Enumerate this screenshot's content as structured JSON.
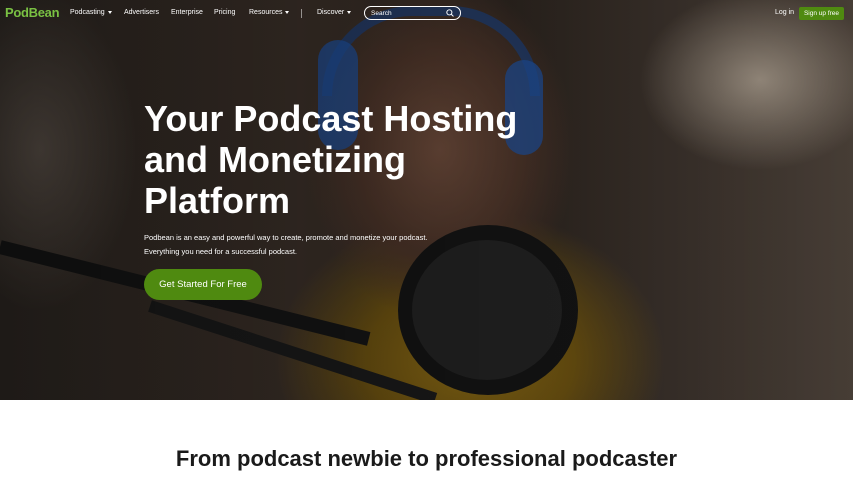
{
  "nav": {
    "logo": "PodBean",
    "items": [
      {
        "label": "Podcasting",
        "dropdown": true
      },
      {
        "label": "Advertisers",
        "dropdown": false
      },
      {
        "label": "Enterprise",
        "dropdown": false
      },
      {
        "label": "Pricing",
        "dropdown": false
      },
      {
        "label": "Resources",
        "dropdown": true
      },
      {
        "label": "Discover",
        "dropdown": true
      }
    ],
    "search_placeholder": "Search",
    "login": "Log in",
    "signup": "Sign up free"
  },
  "hero": {
    "headline": "Your Podcast Hosting and Monetizing Platform",
    "subtext": "Podbean is an easy and powerful way to create, promote and monetize your podcast. Everything you need for a successful podcast.",
    "cta": "Get Started For Free"
  },
  "section": {
    "title": "From podcast newbie to professional podcaster"
  },
  "colors": {
    "brand_green": "#4f8a10",
    "logo_green": "#7ac143"
  }
}
